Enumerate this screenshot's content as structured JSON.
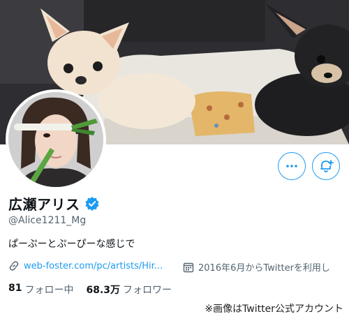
{
  "profile": {
    "display_name": "広瀬アリス",
    "handle": "@Alice1211_Mg",
    "bio": "ぱーぷーとぷーぴーな感じで",
    "verified": true,
    "website": "web-foster.com/pc/artists/Hir...",
    "joined": "2016年6月からTwitterを利用し",
    "following_count": "81",
    "following_label": "フォロー中",
    "followers_count": "68.3万",
    "followers_label": "フォロワー"
  },
  "icons": {
    "more": "more-options-icon",
    "notify": "bell-plus-icon",
    "verified": "verified-badge-icon",
    "link": "link-icon",
    "calendar": "calendar-icon"
  },
  "colors": {
    "accent": "#1d9bf0",
    "text": "#0f1419",
    "secondary_text": "#536471"
  },
  "footnote": "※画像はTwitter公式アカウント"
}
